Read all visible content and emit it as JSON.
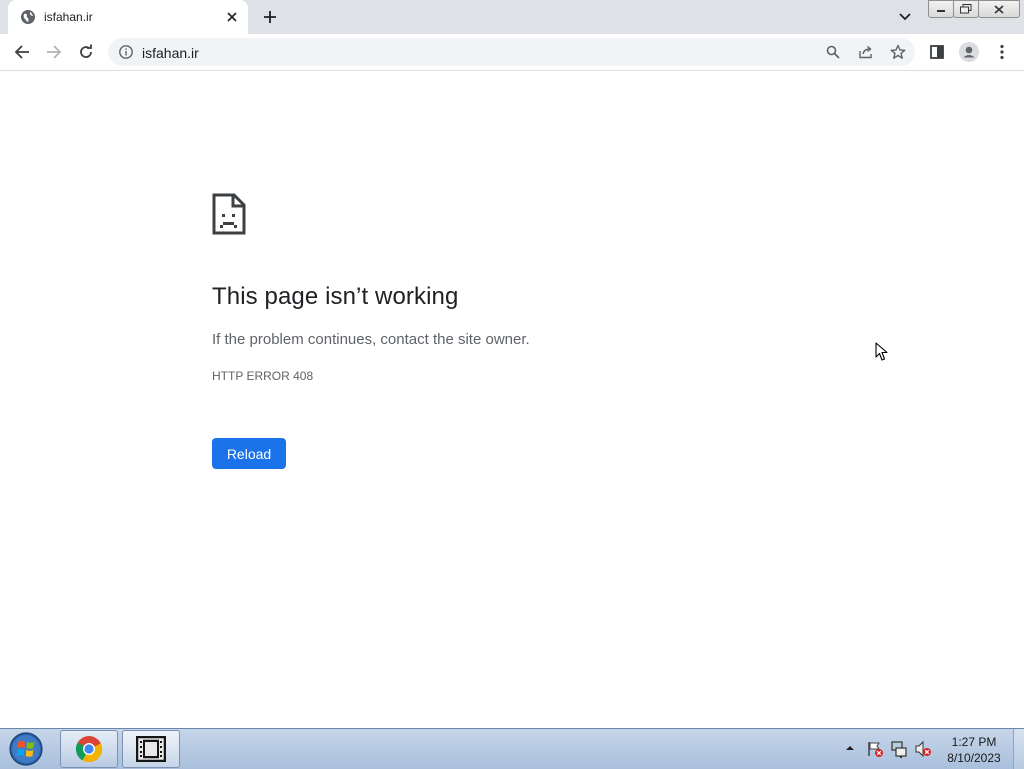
{
  "browser": {
    "tab": {
      "title": "isfahan.ir",
      "favicon": "globe-icon"
    },
    "address": {
      "url": "isfahan.ir"
    }
  },
  "page": {
    "heading": "This page isn’t working",
    "message": "If the problem continues, contact the site owner.",
    "error_code": "HTTP ERROR 408",
    "reload_label": "Reload",
    "accent": "#1a73e8"
  },
  "taskbar": {
    "apps": [
      "chrome-icon",
      "media-player-icon"
    ],
    "time": "1:27 PM",
    "date": "8/10/2023"
  }
}
